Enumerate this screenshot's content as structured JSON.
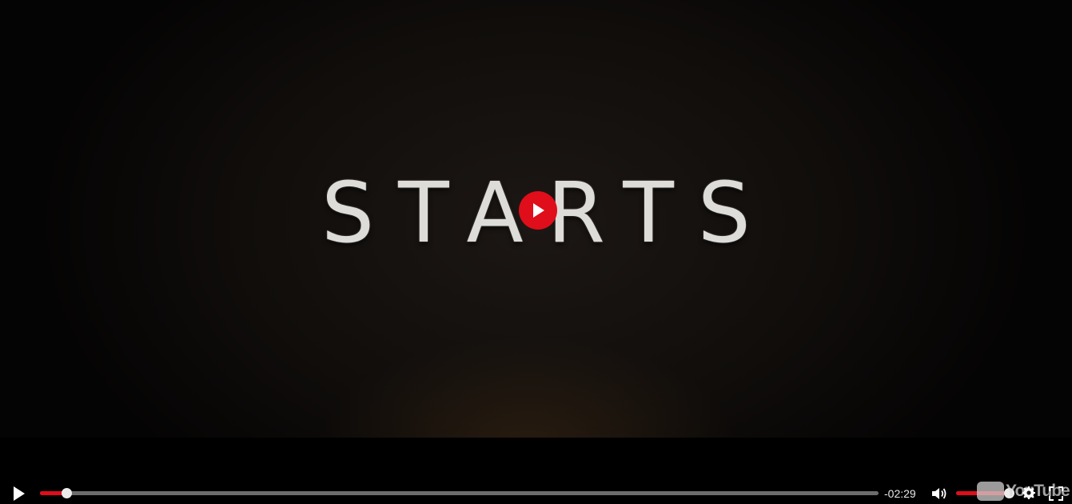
{
  "video": {
    "title_card_text": "STARTS"
  },
  "controls": {
    "progress_fraction": 0.031,
    "time_remaining": "-02:29",
    "volume_fraction": 0.97,
    "logo_text": "YouTube"
  },
  "colors": {
    "accent": "#e00d1a",
    "track": "#6c6c6c",
    "thumb": "#ececec"
  },
  "icons": {
    "big_play": "play-icon",
    "play": "play-icon",
    "volume": "volume-icon",
    "settings": "gear-icon",
    "fullscreen": "fullscreen-icon"
  }
}
